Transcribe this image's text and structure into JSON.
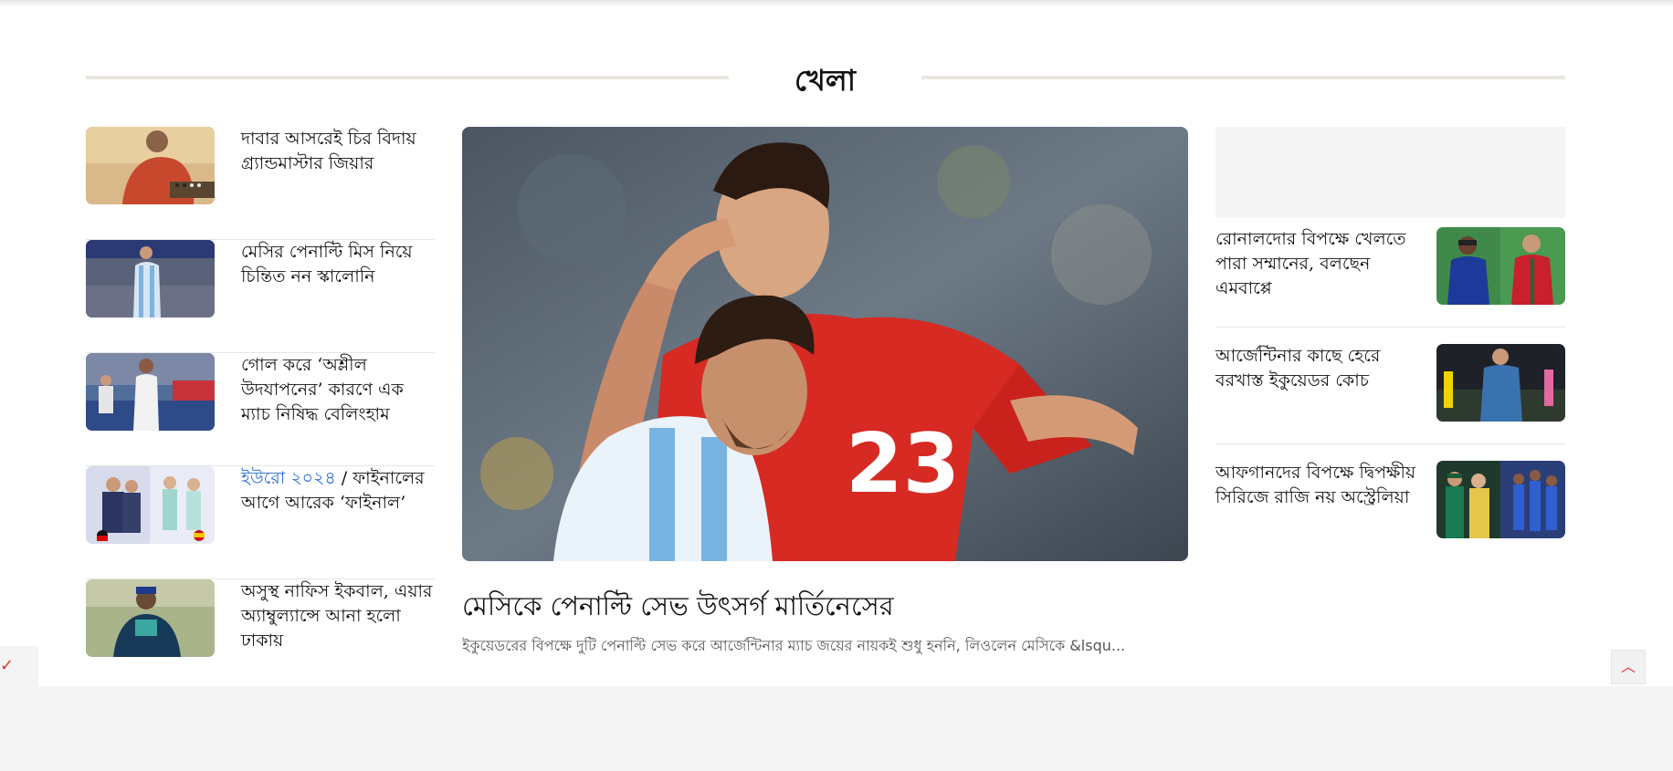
{
  "section": {
    "title": "খেলা"
  },
  "left_stories": [
    {
      "headline": "দাবার আসরেই চির বিদায় গ্র্যান্ডমাস্টার জিয়ার",
      "image": "chess-player-photo"
    },
    {
      "headline": "মেসির পেনাল্টি মিস নিয়ে চিন্তিত নন স্কালোনি",
      "image": "messi-stadium-photo"
    },
    {
      "headline": "গোল করে ‘অশ্লীল উদযাপনের’ কারণে এক ম্যাচ নিষিদ্ধ বেলিংহাম",
      "image": "bellingham-photo"
    },
    {
      "kicker": "ইউরো ২০২৪",
      "separator": " / ",
      "headline": "ফাইনালের আগে আরেক ‘ফাইনাল’",
      "image": "euro-final-photo"
    },
    {
      "headline": "অসুস্থ নাফিস ইকবাল, এয়ার অ্যাম্বুল্যান্সে আনা হলো ঢাকায়",
      "image": "nafis-iqbal-photo"
    }
  ],
  "featured": {
    "title": "মেসিকে পেনাল্টি সেভ উৎসর্গ মার্তিনেসের",
    "summary": "ইকুয়েডরের বিপক্ষে দুটি পেনাল্টি সেভ করে আর্জেন্টিনার ম্যাচ জয়ের নায়কই শুধু হননি, লিওলেন মেসিকে &lsqu...",
    "jersey_number": "23",
    "image": "martinez-messi-celebration-photo"
  },
  "right_stories": [
    {
      "headline": "রোনালদোর বিপক্ষে খেলতে পারা সম্মানের, বলছেন এমবাপ্পে",
      "image": "mbappe-ronaldo-photo"
    },
    {
      "headline": "আর্জেন্টিনার কাছে হেরে বরখাস্ত ইকুয়েডর কোচ",
      "image": "ecuador-coach-photo"
    },
    {
      "headline": "আফগানদের বিপক্ষে দ্বিপক্ষীয় সিরিজে রাজি নয় অস্ট্রেলিয়া",
      "image": "australia-afghanistan-photo"
    }
  ],
  "controls": {
    "scroll_top_icon": "chevron-up-icon",
    "left_tab_icon": "check-icon"
  },
  "colors": {
    "accent": "#e03131",
    "link": "#2a6fd6",
    "divider": "#e8e6df"
  }
}
